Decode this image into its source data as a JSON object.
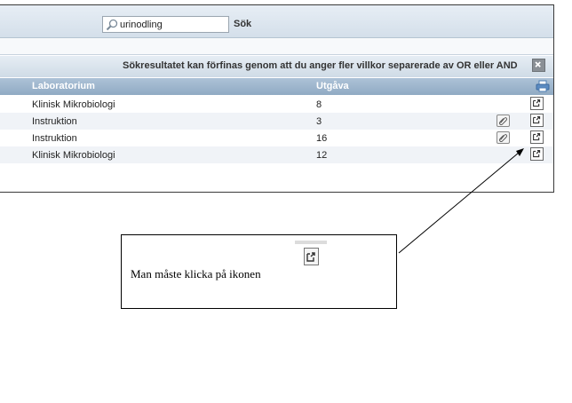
{
  "search": {
    "value": "urinodling",
    "button_label": "Sök"
  },
  "info": {
    "message": "Sökresultatet kan förfinas genom att du anger fler villkor separerade av OR eller AND"
  },
  "table": {
    "headers": {
      "laboratorium": "Laboratorium",
      "utgava": "Utgåva"
    },
    "rows": [
      {
        "laboratorium": "Klinisk Mikrobiologi",
        "utgava": "8",
        "attachment": false
      },
      {
        "laboratorium": "Instruktion",
        "utgava": "3",
        "attachment": true
      },
      {
        "laboratorium": "Instruktion",
        "utgava": "16",
        "attachment": true
      },
      {
        "laboratorium": "Klinisk Mikrobiologi",
        "utgava": "12",
        "attachment": false
      }
    ]
  },
  "callout": {
    "text": "Man måste klicka på ikonen"
  },
  "icons": {
    "search": "magnifier-icon",
    "close": "close-icon",
    "print": "print-icon",
    "attachment": "paperclip-icon",
    "open": "open-external-icon"
  },
  "colors": {
    "header_blue": "#9db4cc",
    "info_bar": "#dde6ef",
    "close_gray": "#8a8f95"
  }
}
